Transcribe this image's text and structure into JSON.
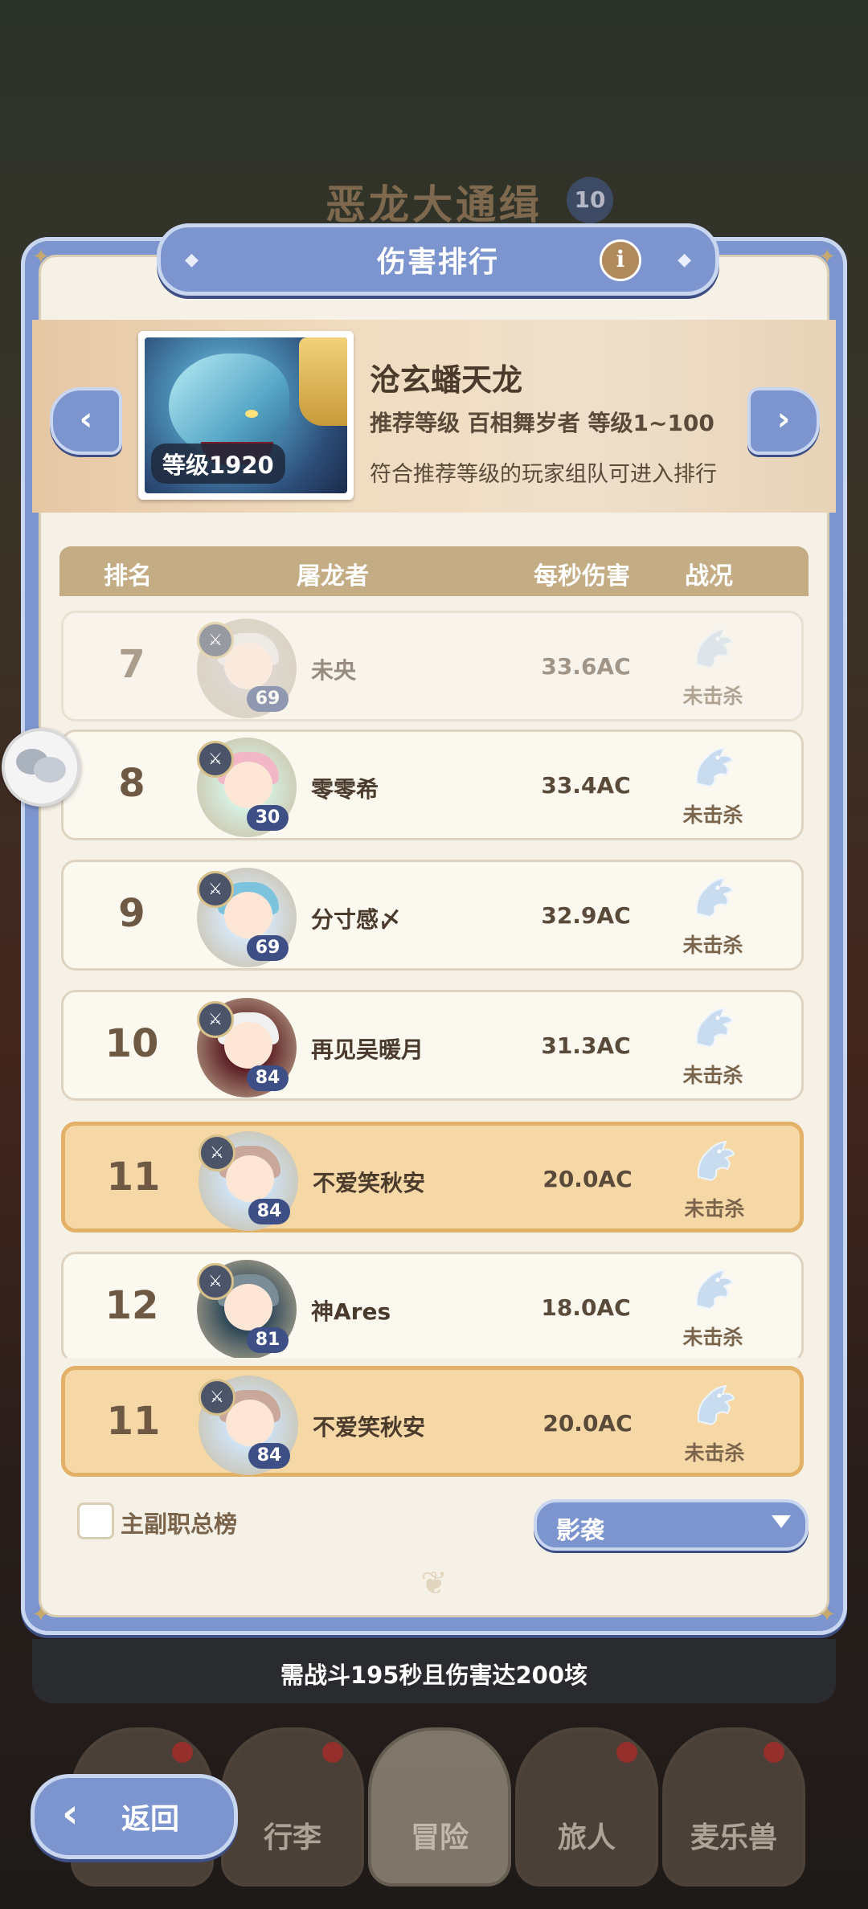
{
  "background": {
    "title": "恶龙大通缉",
    "badge": "10"
  },
  "panel": {
    "title": "伤害排行",
    "info_icon": "info-icon"
  },
  "boss": {
    "name": "沧玄蟠天龙",
    "level_tag": "等级1920",
    "recommendation": "推荐等级 百相舞岁者 等级1~100",
    "note": "符合推荐等级的玩家组队可进入排行"
  },
  "table": {
    "headers": [
      "排名",
      "屠龙者",
      "每秒伤害",
      "战况"
    ],
    "rows": [
      {
        "rank": "7",
        "name": "未央",
        "level": "69",
        "dps": "33.6AC",
        "status": "未击杀",
        "av": "#c9c4c2",
        "hair": "#e9e6e6"
      },
      {
        "rank": "8",
        "name": "零零希",
        "level": "30",
        "dps": "33.4AC",
        "status": "未击杀",
        "av": "#d6efe2",
        "hair": "#f2b7c6"
      },
      {
        "rank": "9",
        "name": "分寸感〆",
        "level": "69",
        "dps": "32.9AC",
        "status": "未击杀",
        "av": "#d7e7f5",
        "hair": "#7cc4de"
      },
      {
        "rank": "10",
        "name": "再见吴暖月",
        "level": "84",
        "dps": "31.3AC",
        "status": "未击杀",
        "av": "#5b1d24",
        "hair": "#f0f0f0"
      },
      {
        "rank": "11",
        "name": "不爱笑秋安",
        "level": "84",
        "dps": "20.0AC",
        "status": "未击杀",
        "av": "#cfe3f4",
        "hair": "#c9a79a"
      },
      {
        "rank": "12",
        "name": "神Ares",
        "level": "81",
        "dps": "18.0AC",
        "status": "未击杀",
        "av": "#2d4757",
        "hair": "#7a8d96"
      }
    ],
    "self_row": {
      "rank": "11",
      "name": "不爱笑秋安",
      "level": "84",
      "dps": "20.0AC",
      "status": "未击杀",
      "av": "#cfe3f4",
      "hair": "#c9a79a"
    }
  },
  "filters": {
    "checkbox_label": "主副职总榜",
    "select_value": "影袭"
  },
  "requirement": "需战斗195秒且伤害达200垓",
  "nav": {
    "items": [
      "行李",
      "冒险",
      "旅人",
      "麦乐兽"
    ],
    "back_label": "返回"
  }
}
